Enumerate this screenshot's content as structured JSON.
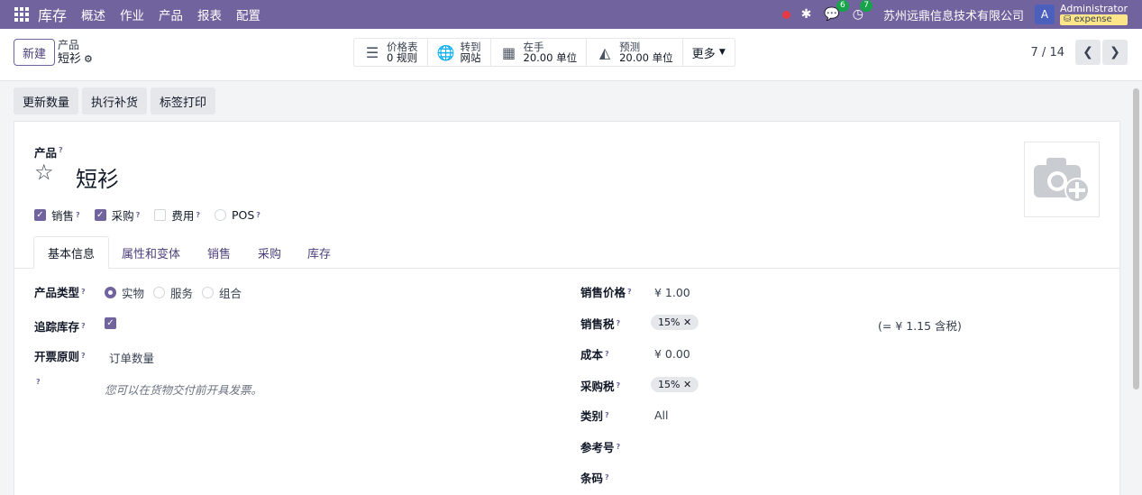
{
  "navbar": {
    "app_name": "库存",
    "menus": [
      "概述",
      "作业",
      "产品",
      "报表",
      "配置"
    ],
    "messages_count": "6",
    "activities_count": "7",
    "company": "苏州远鼎信息技术有限公司",
    "avatar_letter": "A",
    "user_name": "Administrator",
    "database": "expense",
    "accent_color": "#71639e"
  },
  "control_panel": {
    "new_button": "新建",
    "breadcrumb_parent": "产品",
    "breadcrumb_current": "短衫",
    "smart_buttons": [
      {
        "icon": "list-icon",
        "line1": "价格表",
        "line2": "0 规则"
      },
      {
        "icon": "globe-icon",
        "line1": "转到",
        "line2": "网站"
      },
      {
        "icon": "cubes-icon",
        "line1": "在手",
        "line2": "20.00 单位"
      },
      {
        "icon": "area-chart-icon",
        "line1": "预测",
        "line2": "20.00 单位"
      }
    ],
    "more_label": "更多",
    "pager": "7 / 14"
  },
  "actions": [
    "更新数量",
    "执行补货",
    "标签打印"
  ],
  "form": {
    "product_label": "产品",
    "product_name": "短衫",
    "checkboxes": [
      {
        "label": "销售",
        "checked": true
      },
      {
        "label": "采购",
        "checked": true
      },
      {
        "label": "费用",
        "checked": false
      },
      {
        "label": "POS",
        "checked": false
      }
    ],
    "tabs": [
      "基本信息",
      "属性和变体",
      "销售",
      "采购",
      "库存"
    ],
    "left": {
      "product_type_label": "产品类型",
      "product_type_options": [
        "实物",
        "服务",
        "组合"
      ],
      "track_label": "追踪库存",
      "invoice_policy_label": "开票原则",
      "invoice_policy_value": "订单数量",
      "invoice_hint": "您可以在货物交付前开具发票。"
    },
    "right": {
      "sale_price_label": "销售价格",
      "sale_price_value": "¥ 1.00",
      "sale_tax_label": "销售税",
      "sale_tax_value": "15%",
      "tax_included": "(= ¥ 1.15 含税)",
      "cost_label": "成本",
      "cost_value": "¥ 0.00",
      "purchase_tax_label": "采购税",
      "purchase_tax_value": "15%",
      "category_label": "类别",
      "category_value": "All",
      "reference_label": "参考号",
      "barcode_label": "条码"
    }
  }
}
